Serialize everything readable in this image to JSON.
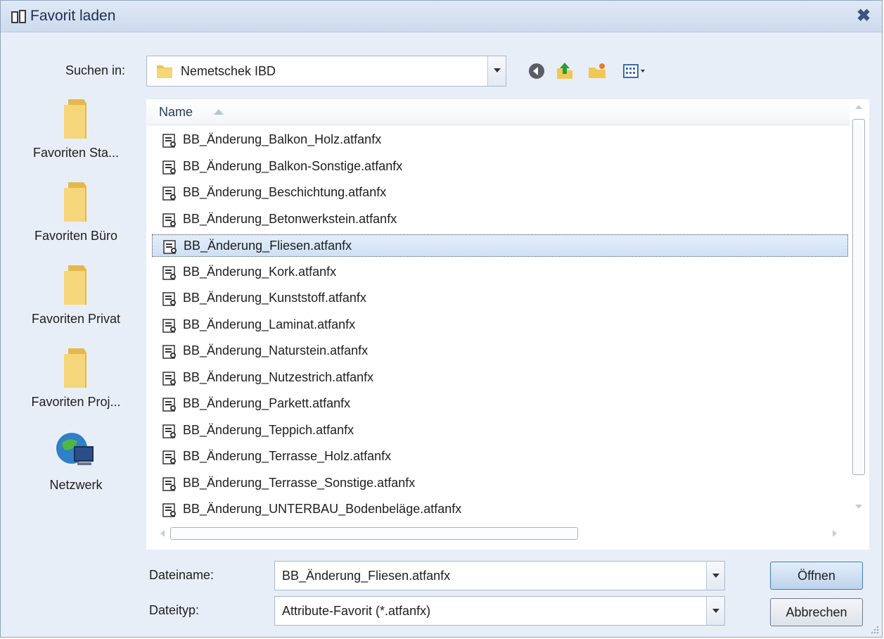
{
  "window": {
    "title": "Favorit laden"
  },
  "lookin": {
    "label": "Suchen in:",
    "value": "Nemetschek IBD"
  },
  "toolbar": {
    "icons": [
      "back-icon",
      "up-folder-icon",
      "new-folder-icon",
      "view-menu-icon"
    ]
  },
  "places": [
    {
      "label": "Favoriten Sta...",
      "icon": "folder-icon"
    },
    {
      "label": "Favoriten Büro",
      "icon": "folder-icon"
    },
    {
      "label": "Favoriten Privat",
      "icon": "folder-icon"
    },
    {
      "label": "Favoriten Proj...",
      "icon": "folder-icon"
    },
    {
      "label": "Netzwerk",
      "icon": "network-icon"
    }
  ],
  "filelist": {
    "column_name": "Name",
    "files": [
      "BB_Änderung_Balkon_Holz.atfanfx",
      "BB_Änderung_Balkon-Sonstige.atfanfx",
      "BB_Änderung_Beschichtung.atfanfx",
      "BB_Änderung_Betonwerkstein.atfanfx",
      "BB_Änderung_Fliesen.atfanfx",
      "BB_Änderung_Kork.atfanfx",
      "BB_Änderung_Kunststoff.atfanfx",
      "BB_Änderung_Laminat.atfanfx",
      "BB_Änderung_Naturstein.atfanfx",
      "BB_Änderung_Nutzestrich.atfanfx",
      "BB_Änderung_Parkett.atfanfx",
      "BB_Änderung_Teppich.atfanfx",
      "BB_Änderung_Terrasse_Holz.atfanfx",
      "BB_Änderung_Terrasse_Sonstige.atfanfx",
      "BB_Änderung_UNTERBAU_Bodenbeläge.atfanfx"
    ],
    "selected_index": 4
  },
  "filename": {
    "label": "Dateiname:",
    "value": "BB_Änderung_Fliesen.atfanfx"
  },
  "filetype": {
    "label": "Dateityp:",
    "value": "Attribute-Favorit (*.atfanfx)"
  },
  "buttons": {
    "open": "Öffnen",
    "cancel": "Abbrechen"
  },
  "colors": {
    "accent": "#3c7fb1",
    "titlebar": "#cddbee",
    "selection": "#cfe0f5"
  }
}
